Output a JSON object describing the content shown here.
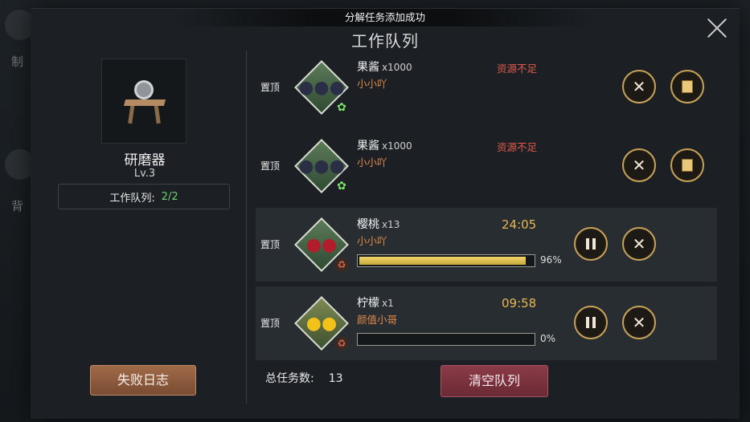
{
  "background": {
    "left_labels": [
      "制",
      "背"
    ]
  },
  "toast": "分解任务添加成功",
  "title": "工作队列",
  "machine": {
    "name": "研磨器",
    "level": "Lv.3",
    "queue_label": "工作队列:",
    "queue_value": "2/2"
  },
  "fail_log_label": "失败日志",
  "pin_label": "置顶",
  "rows": [
    {
      "name": "果酱",
      "qty": "x1000",
      "owner": "小小吖",
      "status": "资源不足",
      "icon": "blueberry-jam-icon",
      "tag": "green-plant-icon"
    },
    {
      "name": "果酱",
      "qty": "x1000",
      "owner": "小小吖",
      "status": "资源不足",
      "icon": "blueberry-jam-icon",
      "tag": "green-plant-icon"
    },
    {
      "name": "樱桃",
      "qty": "x13",
      "owner": "小小吖",
      "timer": "24:05",
      "progress": 0.96,
      "progress_label": "96%",
      "icon": "cherry-icon",
      "tag": "recycle-icon"
    },
    {
      "name": "柠檬",
      "qty": "x1",
      "owner": "颜值小哥",
      "timer": "09:58",
      "progress": 0.0,
      "progress_label": "0%",
      "icon": "lemon-icon",
      "tag": "recycle-icon"
    }
  ],
  "total_label": "总任务数:",
  "total_value": "13",
  "clear_label": "清空队列",
  "colors": {
    "accent_gold": "#c9a259",
    "warning_red": "#e05a4a",
    "owner_orange": "#e0894a",
    "timer_yellow": "#e8b850",
    "queue_green": "#6fd06f"
  }
}
